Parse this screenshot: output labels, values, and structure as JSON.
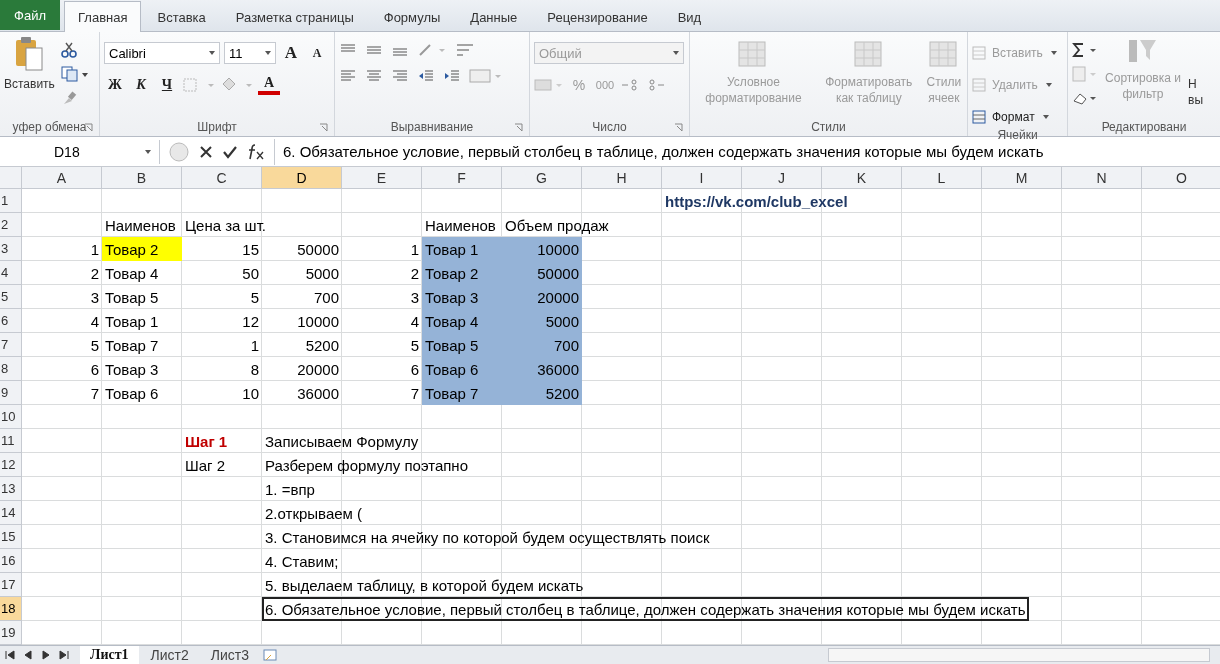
{
  "menu_tabs": [
    {
      "label": "Файл",
      "kind": "file",
      "selected": false
    },
    {
      "label": "Главная",
      "kind": "tab",
      "selected": true
    },
    {
      "label": "Вставка",
      "kind": "tab",
      "selected": false
    },
    {
      "label": "Разметка страницы",
      "kind": "tab",
      "selected": false
    },
    {
      "label": "Формулы",
      "kind": "tab",
      "selected": false
    },
    {
      "label": "Данные",
      "kind": "tab",
      "selected": false
    },
    {
      "label": "Рецензирование",
      "kind": "tab",
      "selected": false
    },
    {
      "label": "Вид",
      "kind": "tab",
      "selected": false
    }
  ],
  "ribbon": {
    "clipboard": {
      "label": "уфер обмена",
      "paste": "Вставить"
    },
    "font": {
      "label": "Шрифт",
      "font_name": "Calibri",
      "font_size": "11",
      "grow": "A",
      "shrink": "A",
      "bold": "Ж",
      "italic": "К",
      "underline": "Ч",
      "font_color": "A"
    },
    "alignment": {
      "label": "Выравнивание"
    },
    "number": {
      "label": "Число",
      "format": "Общий",
      "percent": "%",
      "thousands": "000"
    },
    "styles": {
      "label": "Стили",
      "buttons": [
        {
          "label": "Условное форматирование",
          "disabled": true
        },
        {
          "label": "Форматировать как таблицу",
          "disabled": true
        },
        {
          "label": "Стили ячеек",
          "disabled": true
        }
      ]
    },
    "cells": {
      "label": "Ячейки",
      "buttons": [
        {
          "label": "Вставить",
          "disabled": true
        },
        {
          "label": "Удалить",
          "disabled": true
        },
        {
          "label": "Формат",
          "disabled": false
        }
      ]
    },
    "editing": {
      "label": "Редактировани",
      "sort": {
        "label": "Сортировка и фильтр",
        "disabled": true
      },
      "find": [
        "Н",
        "вы"
      ]
    }
  },
  "formula_bar": {
    "name_box": "D18",
    "formula": "6. Обязательное условие, первый столбец в таблице, должен содержать значения которые мы будем искать"
  },
  "sheet": {
    "columns": [
      {
        "label": "A",
        "selected": false
      },
      {
        "label": "B",
        "selected": false
      },
      {
        "label": "C",
        "selected": false
      },
      {
        "label": "D",
        "selected": true
      },
      {
        "label": "E",
        "selected": false
      },
      {
        "label": "F",
        "selected": false
      },
      {
        "label": "G",
        "selected": false
      },
      {
        "label": "H",
        "selected": false
      },
      {
        "label": "I",
        "selected": false
      },
      {
        "label": "J",
        "selected": false
      },
      {
        "label": "K",
        "selected": false
      },
      {
        "label": "L",
        "selected": false
      },
      {
        "label": "M",
        "selected": false
      },
      {
        "label": "N",
        "selected": false
      },
      {
        "label": "O",
        "selected": false
      }
    ],
    "rows": [
      {
        "number": "1",
        "selected": false,
        "cells": [
          null,
          null,
          null,
          null,
          null,
          null,
          null,
          null,
          {
            "text": "https://vk.com/club_excel",
            "kind": "link"
          }
        ]
      },
      {
        "number": "2",
        "selected": false,
        "cells": [
          null,
          {
            "text": "Наименов",
            "kind": "text"
          },
          {
            "text": "Цена за шт.",
            "kind": "text"
          },
          null,
          null,
          {
            "text": "Наименов",
            "kind": "text"
          },
          {
            "text": "Объем продаж",
            "kind": "text"
          }
        ]
      },
      {
        "number": "3",
        "selected": false,
        "cells": [
          {
            "text": "1",
            "kind": "number"
          },
          {
            "text": "Товар 2",
            "kind": "text",
            "color": "#ffff00"
          },
          {
            "text": "15",
            "kind": "number"
          },
          {
            "text": "50000",
            "kind": "number"
          },
          {
            "text": "1",
            "kind": "number"
          },
          {
            "text": "Товар 1",
            "kind": "text",
            "color": "#95b3d7"
          },
          {
            "text": "10000",
            "kind": "number",
            "color": "#95b3d7"
          }
        ]
      },
      {
        "number": "4",
        "selected": false,
        "cells": [
          {
            "text": "2",
            "kind": "number"
          },
          {
            "text": "Товар 4",
            "kind": "text"
          },
          {
            "text": "50",
            "kind": "number"
          },
          {
            "text": "5000",
            "kind": "number"
          },
          {
            "text": "2",
            "kind": "number"
          },
          {
            "text": "Товар 2",
            "kind": "text",
            "color": "#95b3d7"
          },
          {
            "text": "50000",
            "kind": "number",
            "color": "#95b3d7"
          }
        ]
      },
      {
        "number": "5",
        "selected": false,
        "cells": [
          {
            "text": "3",
            "kind": "number"
          },
          {
            "text": "Товар 5",
            "kind": "text"
          },
          {
            "text": "5",
            "kind": "number"
          },
          {
            "text": "700",
            "kind": "number"
          },
          {
            "text": "3",
            "kind": "number"
          },
          {
            "text": "Товар 3",
            "kind": "text",
            "color": "#95b3d7"
          },
          {
            "text": "20000",
            "kind": "number",
            "color": "#95b3d7"
          }
        ]
      },
      {
        "number": "6",
        "selected": false,
        "cells": [
          {
            "text": "4",
            "kind": "number"
          },
          {
            "text": "Товар 1",
            "kind": "text"
          },
          {
            "text": "12",
            "kind": "number"
          },
          {
            "text": "10000",
            "kind": "number"
          },
          {
            "text": "4",
            "kind": "number"
          },
          {
            "text": "Товар 4",
            "kind": "text",
            "color": "#95b3d7"
          },
          {
            "text": "5000",
            "kind": "number",
            "color": "#95b3d7"
          }
        ]
      },
      {
        "number": "7",
        "selected": false,
        "cells": [
          {
            "text": "5",
            "kind": "number"
          },
          {
            "text": "Товар 7",
            "kind": "text"
          },
          {
            "text": "1",
            "kind": "number"
          },
          {
            "text": "5200",
            "kind": "number"
          },
          {
            "text": "5",
            "kind": "number"
          },
          {
            "text": "Товар 5",
            "kind": "text",
            "color": "#95b3d7"
          },
          {
            "text": "700",
            "kind": "number",
            "color": "#95b3d7"
          }
        ]
      },
      {
        "number": "8",
        "selected": false,
        "cells": [
          {
            "text": "6",
            "kind": "number"
          },
          {
            "text": "Товар 3",
            "kind": "text"
          },
          {
            "text": "8",
            "kind": "number"
          },
          {
            "text": "20000",
            "kind": "number"
          },
          {
            "text": "6",
            "kind": "number"
          },
          {
            "text": "Товар 6",
            "kind": "text",
            "color": "#95b3d7"
          },
          {
            "text": "36000",
            "kind": "number",
            "color": "#95b3d7"
          }
        ]
      },
      {
        "number": "9",
        "selected": false,
        "cells": [
          {
            "text": "7",
            "kind": "number"
          },
          {
            "text": "Товар 6",
            "kind": "text"
          },
          {
            "text": "10",
            "kind": "number"
          },
          {
            "text": "36000",
            "kind": "number"
          },
          {
            "text": "7",
            "kind": "number"
          },
          {
            "text": "Товар 7",
            "kind": "text",
            "color": "#95b3d7"
          },
          {
            "text": "5200",
            "kind": "number",
            "color": "#95b3d7"
          }
        ]
      },
      {
        "number": "10",
        "selected": false,
        "cells": []
      },
      {
        "number": "11",
        "selected": false,
        "cells": [
          null,
          null,
          {
            "text": "Шаг 1",
            "kind": "heading"
          },
          {
            "text": "Записываем Формулу",
            "kind": "text"
          }
        ]
      },
      {
        "number": "12",
        "selected": false,
        "cells": [
          null,
          null,
          {
            "text": "Шаг 2",
            "kind": "text"
          },
          {
            "text": "Разберем формулу поэтапно",
            "kind": "text"
          }
        ]
      },
      {
        "number": "13",
        "selected": false,
        "cells": [
          null,
          null,
          null,
          {
            "text": "1. =впр",
            "kind": "text"
          }
        ]
      },
      {
        "number": "14",
        "selected": false,
        "cells": [
          null,
          null,
          null,
          {
            "text": "2.открываем (",
            "kind": "text"
          }
        ]
      },
      {
        "number": "15",
        "selected": false,
        "cells": [
          null,
          null,
          null,
          {
            "text": "3. Становимся на ячейку по которой будем осуществлять поиск",
            "kind": "text"
          }
        ]
      },
      {
        "number": "16",
        "selected": false,
        "cells": [
          null,
          null,
          null,
          {
            "text": "4. Ставим;",
            "kind": "text"
          }
        ]
      },
      {
        "number": "17",
        "selected": false,
        "cells": [
          null,
          null,
          null,
          {
            "text": "5. выделаем таблицу, в которой будем искать",
            "kind": "text"
          }
        ]
      },
      {
        "number": "18",
        "selected": true,
        "cells": [
          null,
          null,
          null,
          {
            "text": "6. Обязательное условие, первый столбец в таблице, должен содержать значения которые мы будем искать",
            "kind": "text",
            "selected": true
          }
        ]
      },
      {
        "number": "19",
        "selected": false,
        "cells": []
      }
    ]
  },
  "sheet_tabs": [
    {
      "label": "Лист1",
      "selected": true
    },
    {
      "label": "Лист2",
      "selected": false
    },
    {
      "label": "Лист3",
      "selected": false
    }
  ]
}
